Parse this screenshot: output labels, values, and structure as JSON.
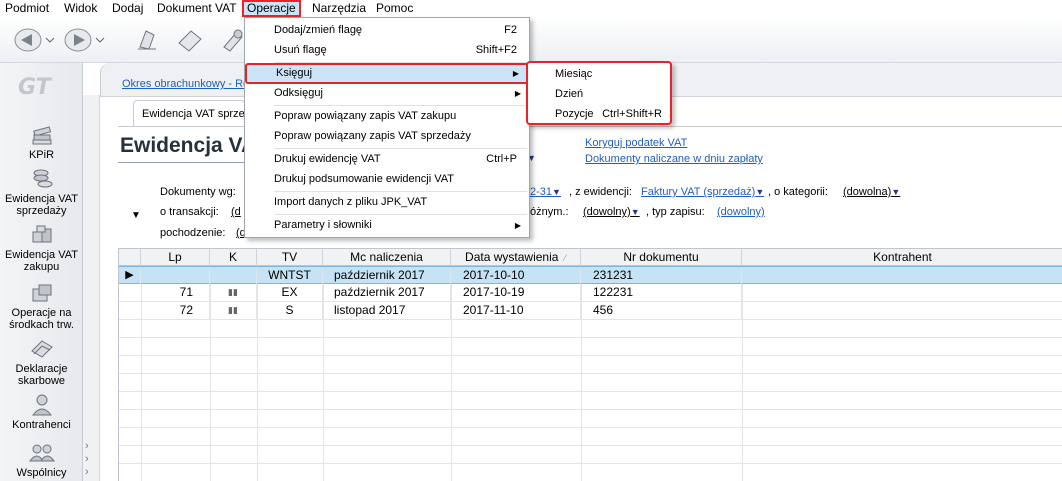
{
  "menubar": {
    "items": [
      "Podmiot",
      "Widok",
      "Dodaj",
      "Dokument VAT",
      "Operacje",
      "Narzędzia",
      "Pomoc"
    ],
    "active": "Operacje"
  },
  "toolbar": {
    "icons": [
      "back-icon",
      "forward-icon",
      "clean-icon",
      "eraser-icon",
      "brush-icon"
    ]
  },
  "leftnav": {
    "logo": "GT",
    "items": [
      {
        "label": "KPiR",
        "icon": "books-icon"
      },
      {
        "label": "Ewidencja VAT sprzedaży",
        "icon": "coins-icon"
      },
      {
        "label": "Ewidencja VAT zakupu",
        "icon": "boxes-icon"
      },
      {
        "label": "Operacje na środkach trw.",
        "icon": "fixed-assets-icon"
      },
      {
        "label": "Deklaracje skarbowe",
        "icon": "declarations-icon"
      },
      {
        "label": "Kontrahenci",
        "icon": "person-icon"
      },
      {
        "label": "Wspólnicy",
        "icon": "partners-icon"
      }
    ]
  },
  "okres_link": "Okres obrachunkowy - Ro",
  "doc_tab": "Ewidencja VAT sprzedaży",
  "page_title": "Ewidencja VAT",
  "right_links": {
    "koryguj": "Koryguj podatek VAT",
    "dokumenty": "Dokumenty naliczane w dniu zapłaty"
  },
  "filters": {
    "dokumenty_wg": "Dokumenty wg:",
    "date_partial": "2-31",
    "z_ewidencji_label": ", z ewidencji:",
    "z_ewidencji_value": "Faktury VAT (sprzedaż)",
    "o_kategorii_label": ", o kategorii:",
    "o_kategorii_value": "(dowolna)",
    "o_transakcji_label": "o transakcji:",
    "o_transakcji_value": "(d",
    "roznym_label": "óżnym.:",
    "roznym_value": "(dowolny)",
    "typ_zapisu_label": ", typ zapisu:",
    "typ_zapisu_value": "(dowolny)",
    "pochodzenie_label": "pochodzenie:",
    "pochodzenie_value": "(d"
  },
  "grid": {
    "columns": [
      "Lp",
      "K",
      "TV",
      "Mc naliczenia",
      "Data wystawienia",
      "Nr dokumentu",
      "Kontrahent"
    ],
    "rows": [
      {
        "lp": "",
        "k": "",
        "tv": "WNTST",
        "mc": "październik 2017",
        "data": "2017-10-10",
        "nr": "231231",
        "kontrahent": "",
        "selected": true
      },
      {
        "lp": "71",
        "k": "book",
        "tv": "EX",
        "mc": "październik 2017",
        "data": "2017-10-19",
        "nr": "122231",
        "kontrahent": "",
        "selected": false
      },
      {
        "lp": "72",
        "k": "book",
        "tv": "S",
        "mc": "listopad 2017",
        "data": "2017-11-10",
        "nr": "456",
        "kontrahent": "",
        "selected": false
      }
    ]
  },
  "dropdown": {
    "items": [
      {
        "label": "Dodaj/zmień flagę",
        "shortcut": "F2"
      },
      {
        "label": "Usuń flagę",
        "shortcut": "Shift+F2"
      },
      {
        "label": "Księguj",
        "submenu": true,
        "highlighted": true
      },
      {
        "label": "Odksięguj",
        "submenu": true
      },
      {
        "label": "Popraw powiązany zapis VAT zakupu"
      },
      {
        "label": "Popraw powiązany zapis VAT sprzedaży"
      },
      {
        "label": "Drukuj ewidencję VAT",
        "shortcut": "Ctrl+P"
      },
      {
        "label": "Drukuj podsumowanie ewidencji VAT"
      },
      {
        "label": "Import danych z pliku JPK_VAT"
      },
      {
        "label": "Parametry i słowniki",
        "submenu": true
      }
    ]
  },
  "submenu": {
    "items": [
      {
        "label": "Miesiąc",
        "shortcut": ""
      },
      {
        "label": "Dzień",
        "shortcut": ""
      },
      {
        "label": "Pozycje",
        "shortcut": "Ctrl+Shift+R"
      }
    ]
  },
  "colors": {
    "accent_red": "#e8232a",
    "highlight_blue": "#cce4f7",
    "link_blue": "#1f5fbf",
    "selected_row": "#c6e3f6"
  }
}
